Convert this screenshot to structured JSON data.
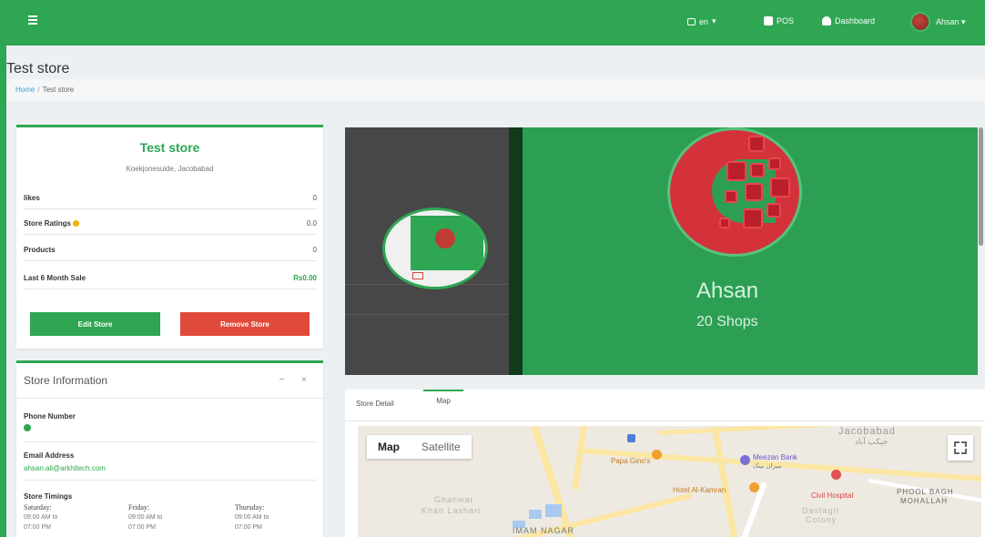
{
  "navbar": {
    "language": "en",
    "pos_label": "POS",
    "dashboard_label": "Dashboard",
    "user_name": "Ahsan"
  },
  "page": {
    "title": "Test store",
    "breadcrumb": {
      "home": "Home",
      "separator": "/",
      "current": "Test store"
    }
  },
  "store_card": {
    "name": "Test store",
    "address": "Koekjonesuide, Jacobabad",
    "stats": [
      {
        "label": "likes",
        "value": "0"
      },
      {
        "label": "Store Ratings",
        "value": "0.0"
      },
      {
        "label": "Products",
        "value": "0"
      },
      {
        "label": "Last 6 Month Sale",
        "value": "Rs0.00"
      }
    ],
    "edit_label": "Edit Store",
    "remove_label": "Remove Store"
  },
  "store_info": {
    "title": "Store Information",
    "tools": "− ×",
    "phone_label": "Phone Number",
    "email_label": "Email Address",
    "email_value": "ahsan.ali@arkhitech.com",
    "timings_label": "Store Timings",
    "timings": [
      {
        "day": "Saturday:",
        "from": "09:00 AM to",
        "to": "07:00 PM"
      },
      {
        "day": "Friday:",
        "from": "09:00 AM to",
        "to": "07:00 PM"
      },
      {
        "day": "Thursday:",
        "from": "09:00 AM to",
        "to": "07:00 PM"
      }
    ]
  },
  "banner": {
    "name": "Ahsan",
    "shops": "20 Shops"
  },
  "tabs": [
    {
      "label": "Store Detail"
    },
    {
      "label": "Map"
    }
  ],
  "map": {
    "map_label": "Map",
    "satellite_label": "Satellite",
    "places": {
      "papa_gino": "Papa Gino's",
      "meezan_bank": "Meezan Bank",
      "meezan_bank_urdu": "میزان بینک",
      "hotel": "Hotel Al-Kamran",
      "hospital": "Civil Hospital",
      "city": "Jacobabad",
      "city_urdu": "جیکب آباد",
      "phool_bagh": "PHOOL BAGH",
      "mohallah": "MOHALLAH",
      "ghanwar": "Ghanwar",
      "khan_lashari": "Khan Lashari",
      "imam_nagar": "IMAM NAGAR",
      "dastagir": "Dastagir",
      "colony": "Colony"
    }
  },
  "colors": {
    "brand_green": "#2ea652",
    "danger_red": "#e04a3a",
    "link_blue": "#3aa0d8"
  }
}
